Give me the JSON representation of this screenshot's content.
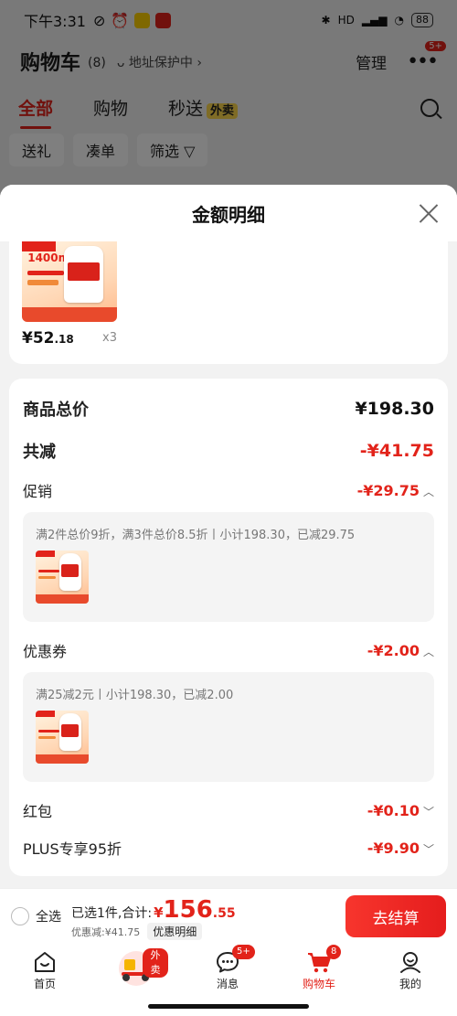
{
  "status_bar": {
    "time": "下午3:31",
    "signal": "HD",
    "battery": "88"
  },
  "header": {
    "title": "购物车",
    "count": "(8)",
    "address_protect": "地址保护中",
    "manage": "管理",
    "more_badge": "5+"
  },
  "tabs": [
    {
      "label": "全部",
      "active": true
    },
    {
      "label": "购物",
      "active": false
    },
    {
      "label": "秒送",
      "active": false,
      "tag": "外卖"
    }
  ],
  "filters": {
    "items": [
      "送礼",
      "凑单"
    ],
    "filter_label": "筛选"
  },
  "sheet": {
    "title": "金额明细",
    "product": {
      "art_mg": "1400mg",
      "price_int": "¥52",
      "price_dec": ".18",
      "qty": "x3"
    },
    "summary": {
      "total_label": "商品总价",
      "total_value": "¥198.30",
      "discount_label": "共减",
      "discount_value": "-¥41.75"
    },
    "promo": {
      "label": "促销",
      "value": "-¥29.75",
      "desc": "满2件总价9折，满3件总价8.5折丨小计198.30，已减29.75"
    },
    "coupon": {
      "label": "优惠券",
      "value": "-¥2.00",
      "desc": "满25减2元丨小计198.30，已减2.00"
    },
    "redpacket": {
      "label": "红包",
      "value": "-¥0.10"
    },
    "plus": {
      "label": "PLUS专享95折",
      "value": "-¥9.90"
    }
  },
  "checkout": {
    "select_all": "全选",
    "selected_text": "已选1件,合计:",
    "yen": "¥",
    "total_int": "156",
    "total_dec": ".55",
    "saved": "优惠减:¥41.75",
    "detail_link": "优惠明细",
    "button": "去结算"
  },
  "nav": [
    {
      "label": "首页",
      "icon": "home-icon"
    },
    {
      "label": "",
      "icon": "delivery-scooter-icon",
      "tag": "外卖"
    },
    {
      "label": "消息",
      "icon": "message-icon",
      "badge": "5+"
    },
    {
      "label": "购物车",
      "icon": "cart-icon",
      "badge": "8",
      "active": true
    },
    {
      "label": "我的",
      "icon": "profile-icon"
    }
  ],
  "colors": {
    "accent": "#e2231a",
    "sheet_bg": "#f2f2f2",
    "card_bg": "#ffffff"
  }
}
